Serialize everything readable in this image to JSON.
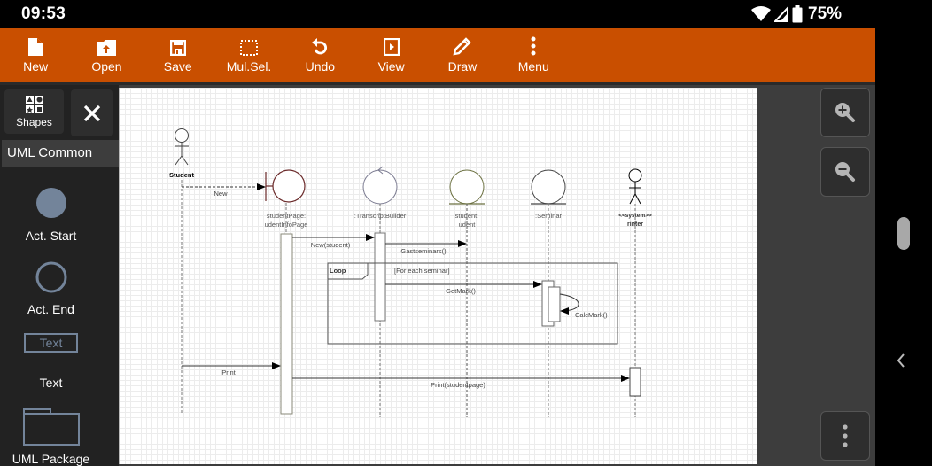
{
  "status_bar": {
    "time": "09:53",
    "battery_percent": "75%",
    "icons": [
      "wifi-icon",
      "cell-signal-icon",
      "battery-icon"
    ]
  },
  "toolbar": {
    "color": "#c94f00",
    "items": [
      {
        "label": "New",
        "icon": "new-file-icon"
      },
      {
        "label": "Open",
        "icon": "open-folder-icon"
      },
      {
        "label": "Save",
        "icon": "save-icon"
      },
      {
        "label": "Mul.Sel.",
        "icon": "multi-select-icon"
      },
      {
        "label": "Undo",
        "icon": "undo-icon"
      },
      {
        "label": "View",
        "icon": "view-icon"
      },
      {
        "label": "Draw",
        "icon": "pencil-icon"
      },
      {
        "label": "Menu",
        "icon": "more-vert-icon"
      }
    ]
  },
  "sidebar": {
    "shapes_label": "Shapes",
    "category": "UML Common",
    "items": [
      {
        "label": "Act. Start",
        "icon": "activity-start-icon"
      },
      {
        "label": "Act. End",
        "icon": "activity-end-icon"
      },
      {
        "label": "Text",
        "preview_text": "Text",
        "icon": "text-box-icon"
      },
      {
        "label": "UML Package",
        "icon": "uml-package-icon"
      }
    ]
  },
  "diagram": {
    "lifelines": [
      {
        "type": "actor",
        "label": "Student"
      },
      {
        "type": "boundary",
        "label_line1": "studentPage:",
        "label_line2": "udentInfoPage"
      },
      {
        "type": "control",
        "label_line1": ":TranscriptBuilder",
        "label_line2": ""
      },
      {
        "type": "entity",
        "label_line1": "student:",
        "label_line2": "udent"
      },
      {
        "type": "entity",
        "label_line1": ":Seminar",
        "label_line2": ""
      },
      {
        "type": "actor",
        "label_line1": "<<system>>",
        "label_line2": "rinter"
      }
    ],
    "messages": [
      {
        "label": "New",
        "style": "dashed"
      },
      {
        "label": "New(student)",
        "style": "solid"
      },
      {
        "label": "Gastseminars()",
        "style": "solid"
      },
      {
        "label": "GetMark()",
        "style": "solid"
      },
      {
        "label": "CalcMark()",
        "style": "self"
      },
      {
        "label": "Print",
        "style": "solid"
      },
      {
        "label": "Print(studentpage)",
        "style": "solid"
      }
    ],
    "fragment": {
      "operator": "Loop",
      "guard": "[For each seminar]"
    }
  },
  "right_panel": {
    "zoom_in": "zoom-in-icon",
    "zoom_out": "zoom-out-icon",
    "more": "more-vert-icon"
  }
}
